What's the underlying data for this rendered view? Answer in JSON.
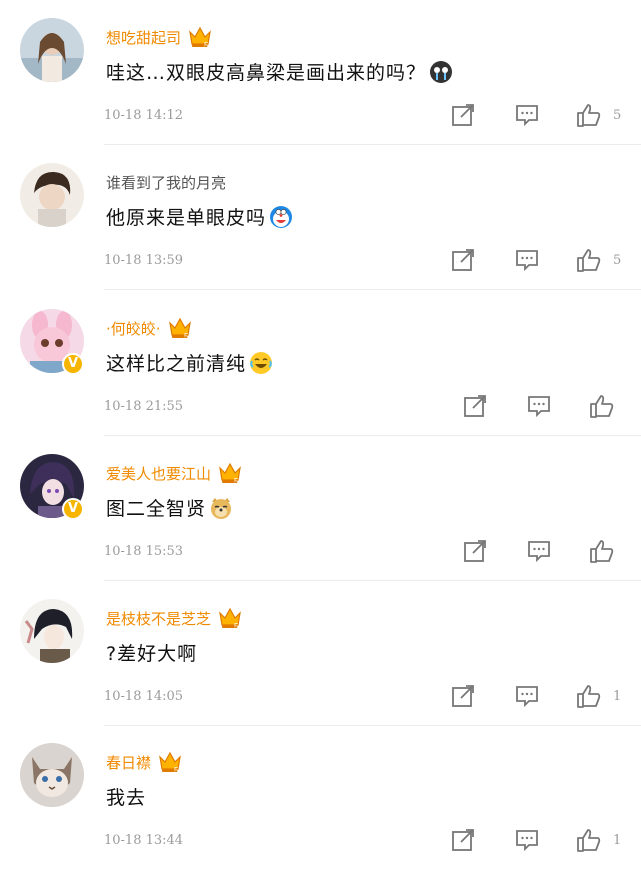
{
  "comments": [
    {
      "user": "想吃甜起司",
      "vip": true,
      "verified": false,
      "text": "哇这…双眼皮高鼻梁是画出来的吗？",
      "emoji": "cry-emoji",
      "time": "10-18 14:12",
      "likes": "5"
    },
    {
      "user": "谁看到了我的月亮",
      "vip": false,
      "verified": false,
      "text": "他原来是单眼皮吗",
      "emoji": "doraemon-emoji",
      "time": "10-18 13:59",
      "likes": "5"
    },
    {
      "user": "·何皎皎·",
      "vip": true,
      "verified": true,
      "text": "这样比之前清纯",
      "emoji": "laugh-emoji",
      "time": "10-18 21:55",
      "likes": ""
    },
    {
      "user": "爱美人也要江山",
      "vip": true,
      "verified": true,
      "text": "图二全智贤",
      "emoji": "doge-emoji",
      "time": "10-18 15:53",
      "likes": ""
    },
    {
      "user": "是枝枝不是芝芝",
      "vip": true,
      "verified": false,
      "text": "?差好大啊",
      "emoji": "",
      "time": "10-18 14:05",
      "likes": "1"
    },
    {
      "user": "春日襟",
      "vip": true,
      "verified": false,
      "text": "我去",
      "emoji": "",
      "time": "10-18 13:44",
      "likes": "1"
    }
  ],
  "icons": {
    "share": "share-icon",
    "reply": "comment-icon",
    "like": "thumbs-up-icon",
    "vip": "crown-badge-icon"
  },
  "colors": {
    "username_vip": "#f08a00",
    "verified_badge": "#f7b500"
  }
}
